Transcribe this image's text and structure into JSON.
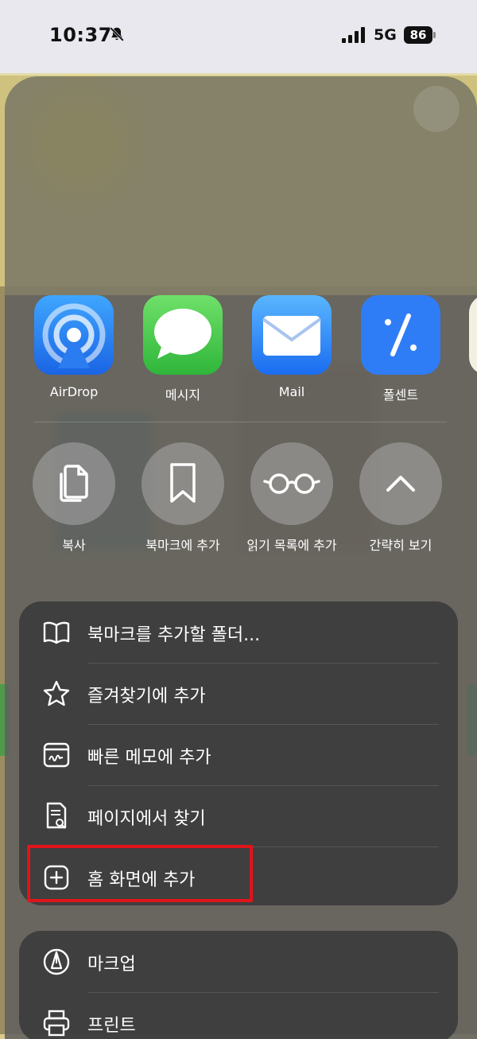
{
  "status_bar": {
    "time": "10:37",
    "network": "5G",
    "battery": "86"
  },
  "share_apps": [
    {
      "label": "AirDrop",
      "icon": "airdrop-icon"
    },
    {
      "label": "메시지",
      "icon": "messages-icon"
    },
    {
      "label": "Mail",
      "icon": "mail-icon"
    },
    {
      "label": "폴센트",
      "icon": "percent-icon"
    }
  ],
  "quick_actions": [
    {
      "label": "복사",
      "icon": "copy-icon"
    },
    {
      "label": "북마크에 추가",
      "icon": "bookmark-icon"
    },
    {
      "label": "읽기 목록에 추가",
      "icon": "glasses-icon"
    },
    {
      "label": "간략히 보기",
      "icon": "chevron-up-icon"
    }
  ],
  "menu_group_1": [
    {
      "label": "북마크를 추가할 폴더...",
      "icon": "book-icon"
    },
    {
      "label": "즐겨찾기에 추가",
      "icon": "star-icon"
    },
    {
      "label": "빠른 메모에 추가",
      "icon": "quick-note-icon"
    },
    {
      "label": "페이지에서 찾기",
      "icon": "find-in-page-icon"
    },
    {
      "label": "홈 화면에 추가",
      "icon": "add-square-icon"
    }
  ],
  "menu_group_2": [
    {
      "label": "마크업",
      "icon": "markup-icon"
    },
    {
      "label": "프린트",
      "icon": "printer-icon"
    }
  ],
  "colors": {
    "highlight": "#e1141a",
    "sheet": "#5f5f5f",
    "menu": "#3c3c3e"
  }
}
